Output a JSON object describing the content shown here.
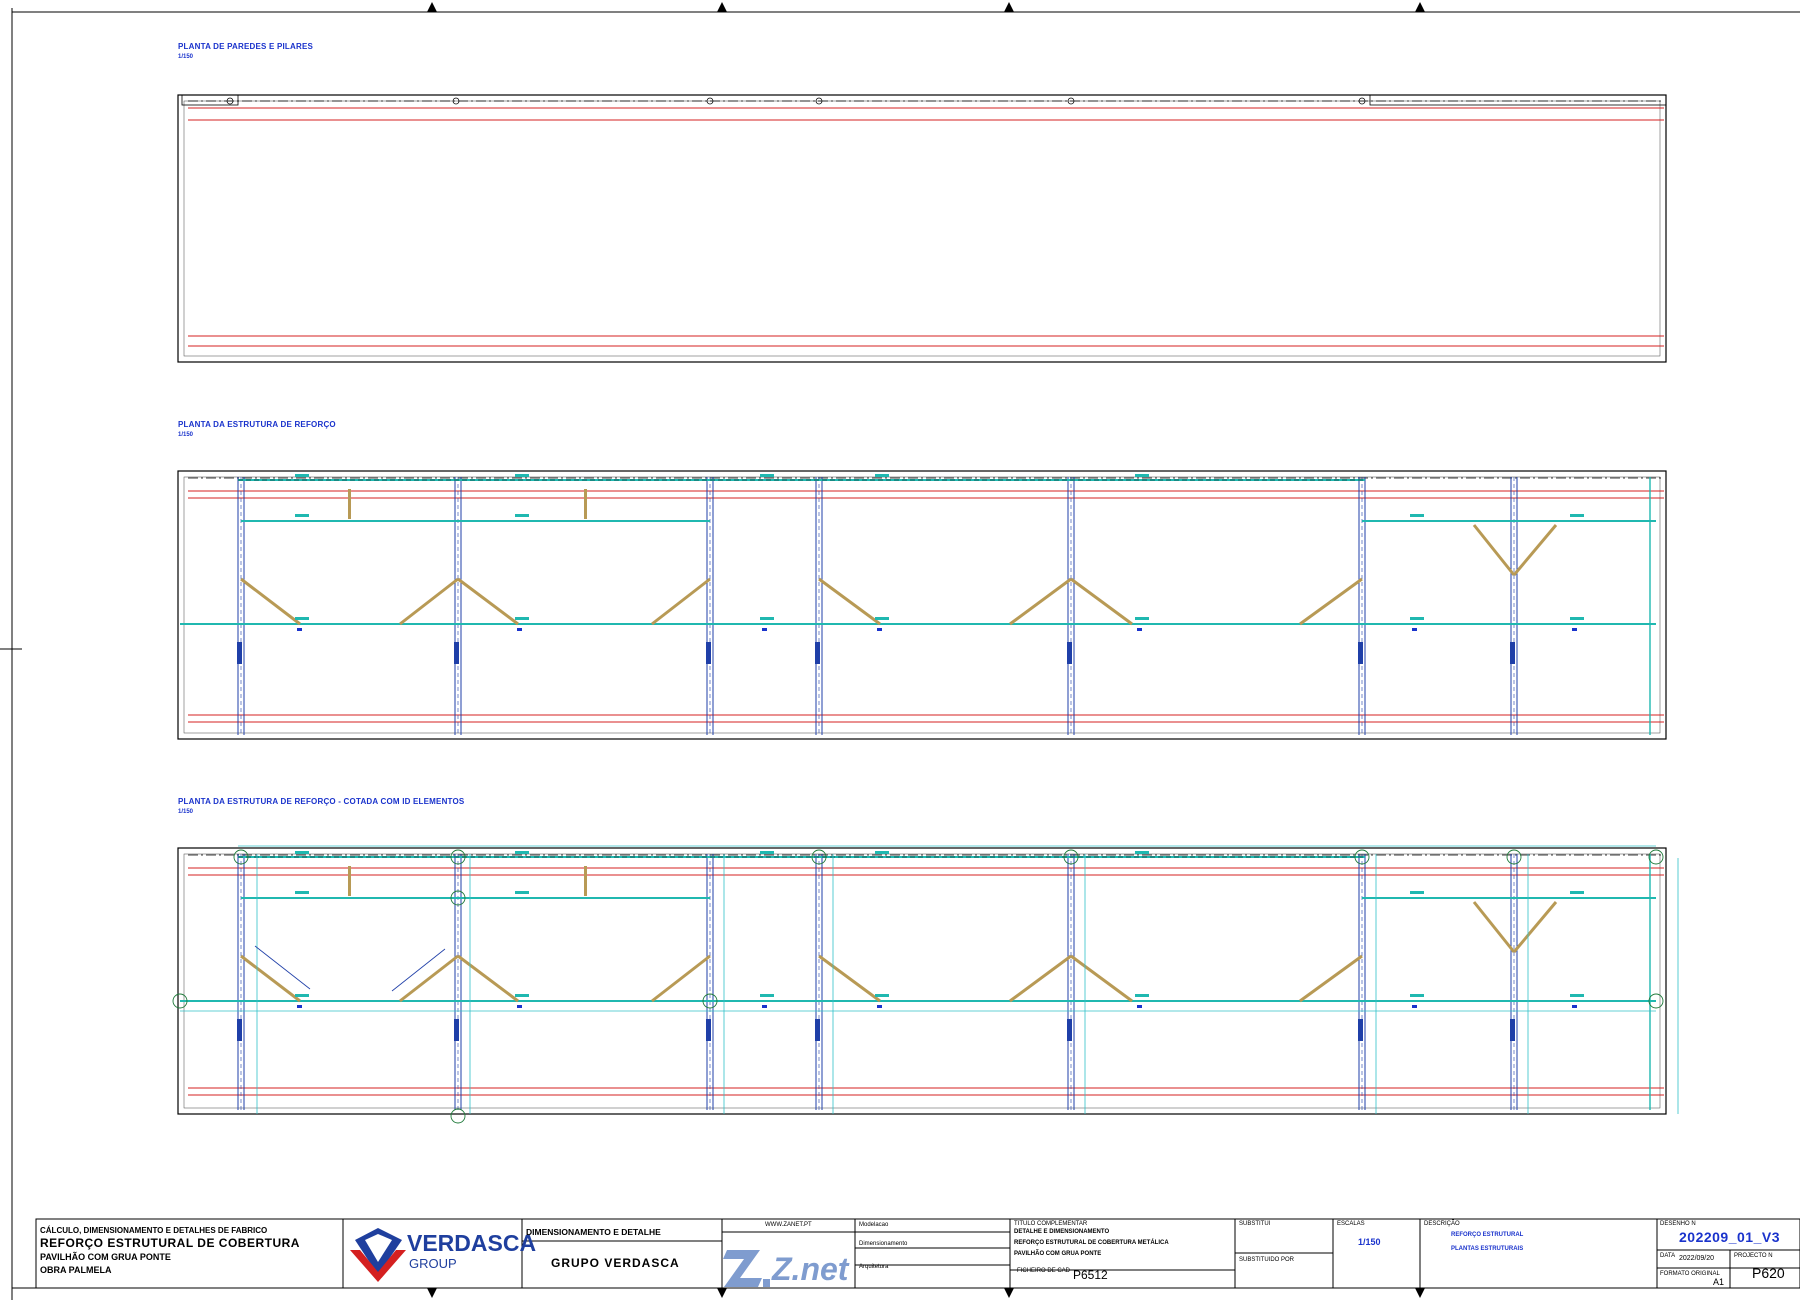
{
  "plans": [
    {
      "title": "PLANTA DE PAREDES E PILARES",
      "scale": "1/150"
    },
    {
      "title": "PLANTA DA ESTRUTURA DE REFORÇO",
      "scale": "1/150"
    },
    {
      "title": "PLANTA DA ESTRUTURA DE REFORÇO - COTADA COM ID ELEMENTOS",
      "scale": "1/150"
    }
  ],
  "title_block": {
    "scope_line": "CÁLCULO, DIMENSIONAMENTO E DETALHES DE FABRICO",
    "project_name": "REFORÇO ESTRUTURAL DE COBERTURA",
    "project_sub": "PAVILHÃO COM GRUA PONTE",
    "site": "OBRA PALMELA",
    "client_logo": "VERDASCA",
    "client_logo_sub": "GROUP",
    "service": "DIMENSIONAMENTO E DETALHE",
    "client": "GRUPO VERDASCA",
    "company_url": "WWW.ZANET.PT",
    "company_logo": "Z.net",
    "role_1": "Modelacao",
    "role_2": "Dimensionamento",
    "role_3": "Arquitetura",
    "complement_label": "TITULO COMPLEMENTAR",
    "complement_1": "DETALHE E DIMENSIONAMENTO",
    "complement_2": "REFORÇO ESTRUTURAL DE COBERTURA METÁLICA",
    "complement_3": "PAVILHÃO COM GRUA PONTE",
    "cad_file_label": "FICHEIRO DE CAD",
    "cad_file": "P6512",
    "substitutes_label": "SUBSTITUI",
    "substituted_label": "SUBSTITUIDO POR",
    "scale_label": "ESCALAS",
    "scale": "1/150",
    "description_label": "DESCRIÇÃO",
    "description_1": "REFORÇO ESTRUTURAL",
    "description_2": "PLANTAS ESTRUTURAIS",
    "drawing_label": "DESENHO N",
    "drawing_no": "202209_01_V3",
    "date_label": "DATA",
    "date": "2022/09/20",
    "project_no_label": "PROJECTO N",
    "project_no": "P620",
    "format_label": "FORMATO ORIGINAL",
    "format": "A1"
  },
  "colors": {
    "frame": "#000000",
    "wall_red": "#d42020",
    "column_blue": "#1f3fa8",
    "beam_cyan": "#20b8b0",
    "brace_tan": "#b89a55",
    "dim_cyan": "#30c0c8",
    "label_blue": "#1a33cc"
  }
}
